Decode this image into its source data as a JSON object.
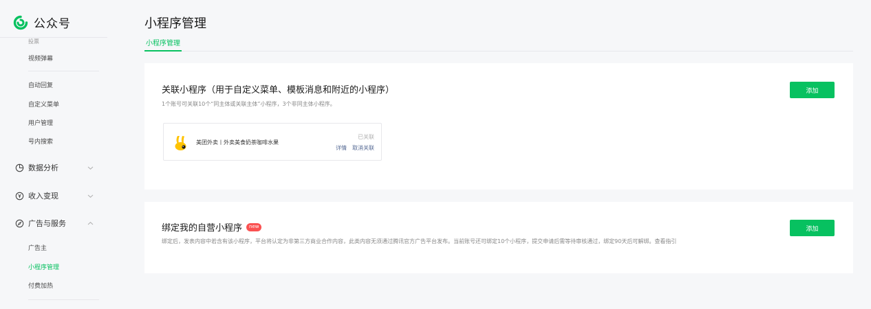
{
  "brand": {
    "name": "公众号",
    "icon": "wechat-official-account-logo",
    "color": "#07c160"
  },
  "page": {
    "title": "小程序管理"
  },
  "tabs": [
    {
      "label": "小程序管理",
      "active": true
    }
  ],
  "sidebar": {
    "clipped_item": "投票",
    "items": [
      {
        "label": "视频弹幕"
      },
      {
        "label": "自动回复"
      },
      {
        "label": "自定义菜单"
      },
      {
        "label": "用户管理"
      },
      {
        "label": "号内搜索"
      }
    ],
    "groups": [
      {
        "label": "数据分析",
        "icon": "clock-icon",
        "expanded": false
      },
      {
        "label": "收入变现",
        "icon": "yuan-coin-icon",
        "expanded": false
      },
      {
        "label": "广告与服务",
        "icon": "compass-icon",
        "expanded": true
      }
    ],
    "ad_items": [
      {
        "label": "广告主",
        "active": false
      },
      {
        "label": "小程序管理",
        "active": true
      },
      {
        "label": "付费加热",
        "active": false
      }
    ]
  },
  "cards": {
    "linked": {
      "title": "关联小程序（用于自定义菜单、模板消息和附近的小程序）",
      "desc": "1个账号可关联10个“同主体或关联主体”小程序，3个非同主体小程序。",
      "add_label": "添加",
      "item": {
        "name": "美团外卖丨外卖美食奶茶咖啡水果",
        "status": "已关联",
        "detail_label": "详情",
        "unlink_label": "取消关联"
      }
    },
    "owned": {
      "title": "绑定我的自营小程序",
      "badge": "new",
      "desc": "绑定后，发表内容中若含有该小程序，平台将认定为非第三方商业合作内容，此类内容无须通过腾讯官方广告平台发布。当前账号还可绑定10个小程序，提交申请后需等待审核通过，绑定90天后可解绑。查看指引",
      "add_label": "添加"
    }
  },
  "colors": {
    "accent": "#07c160",
    "link": "#576b95",
    "badge": "#fa5151"
  }
}
